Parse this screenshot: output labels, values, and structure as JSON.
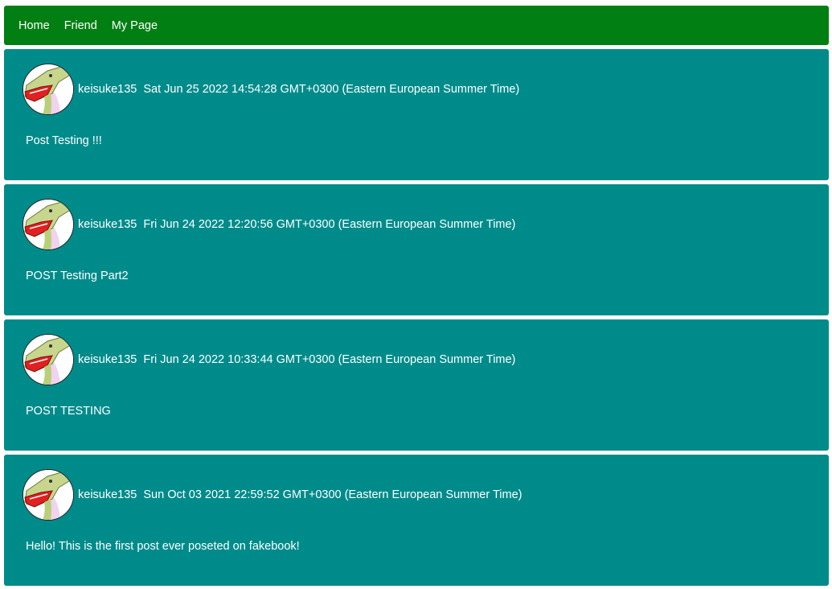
{
  "nav": {
    "items": [
      {
        "label": "Home"
      },
      {
        "label": "Friend"
      },
      {
        "label": "My Page"
      }
    ]
  },
  "colors": {
    "navbar": "#027f13",
    "post_bg": "#008b8b",
    "text": "#ffffff"
  },
  "posts": [
    {
      "author": "keisuke135",
      "timestamp": "Sat Jun 25 2022 14:54:28 GMT+0300 (Eastern European Summer Time)",
      "content": "Post Testing !!!",
      "avatar_icon": "crocodile-avatar-icon"
    },
    {
      "author": "keisuke135",
      "timestamp": "Fri Jun 24 2022 12:20:56 GMT+0300 (Eastern European Summer Time)",
      "content": "POST Testing Part2",
      "avatar_icon": "crocodile-avatar-icon"
    },
    {
      "author": "keisuke135",
      "timestamp": "Fri Jun 24 2022 10:33:44 GMT+0300 (Eastern European Summer Time)",
      "content": "POST TESTING",
      "avatar_icon": "crocodile-avatar-icon"
    },
    {
      "author": "keisuke135",
      "timestamp": "Sun Oct 03 2021 22:59:52 GMT+0300 (Eastern European Summer Time)",
      "content": "Hello! This is the first post ever poseted on fakebook!",
      "avatar_icon": "crocodile-avatar-icon"
    }
  ]
}
